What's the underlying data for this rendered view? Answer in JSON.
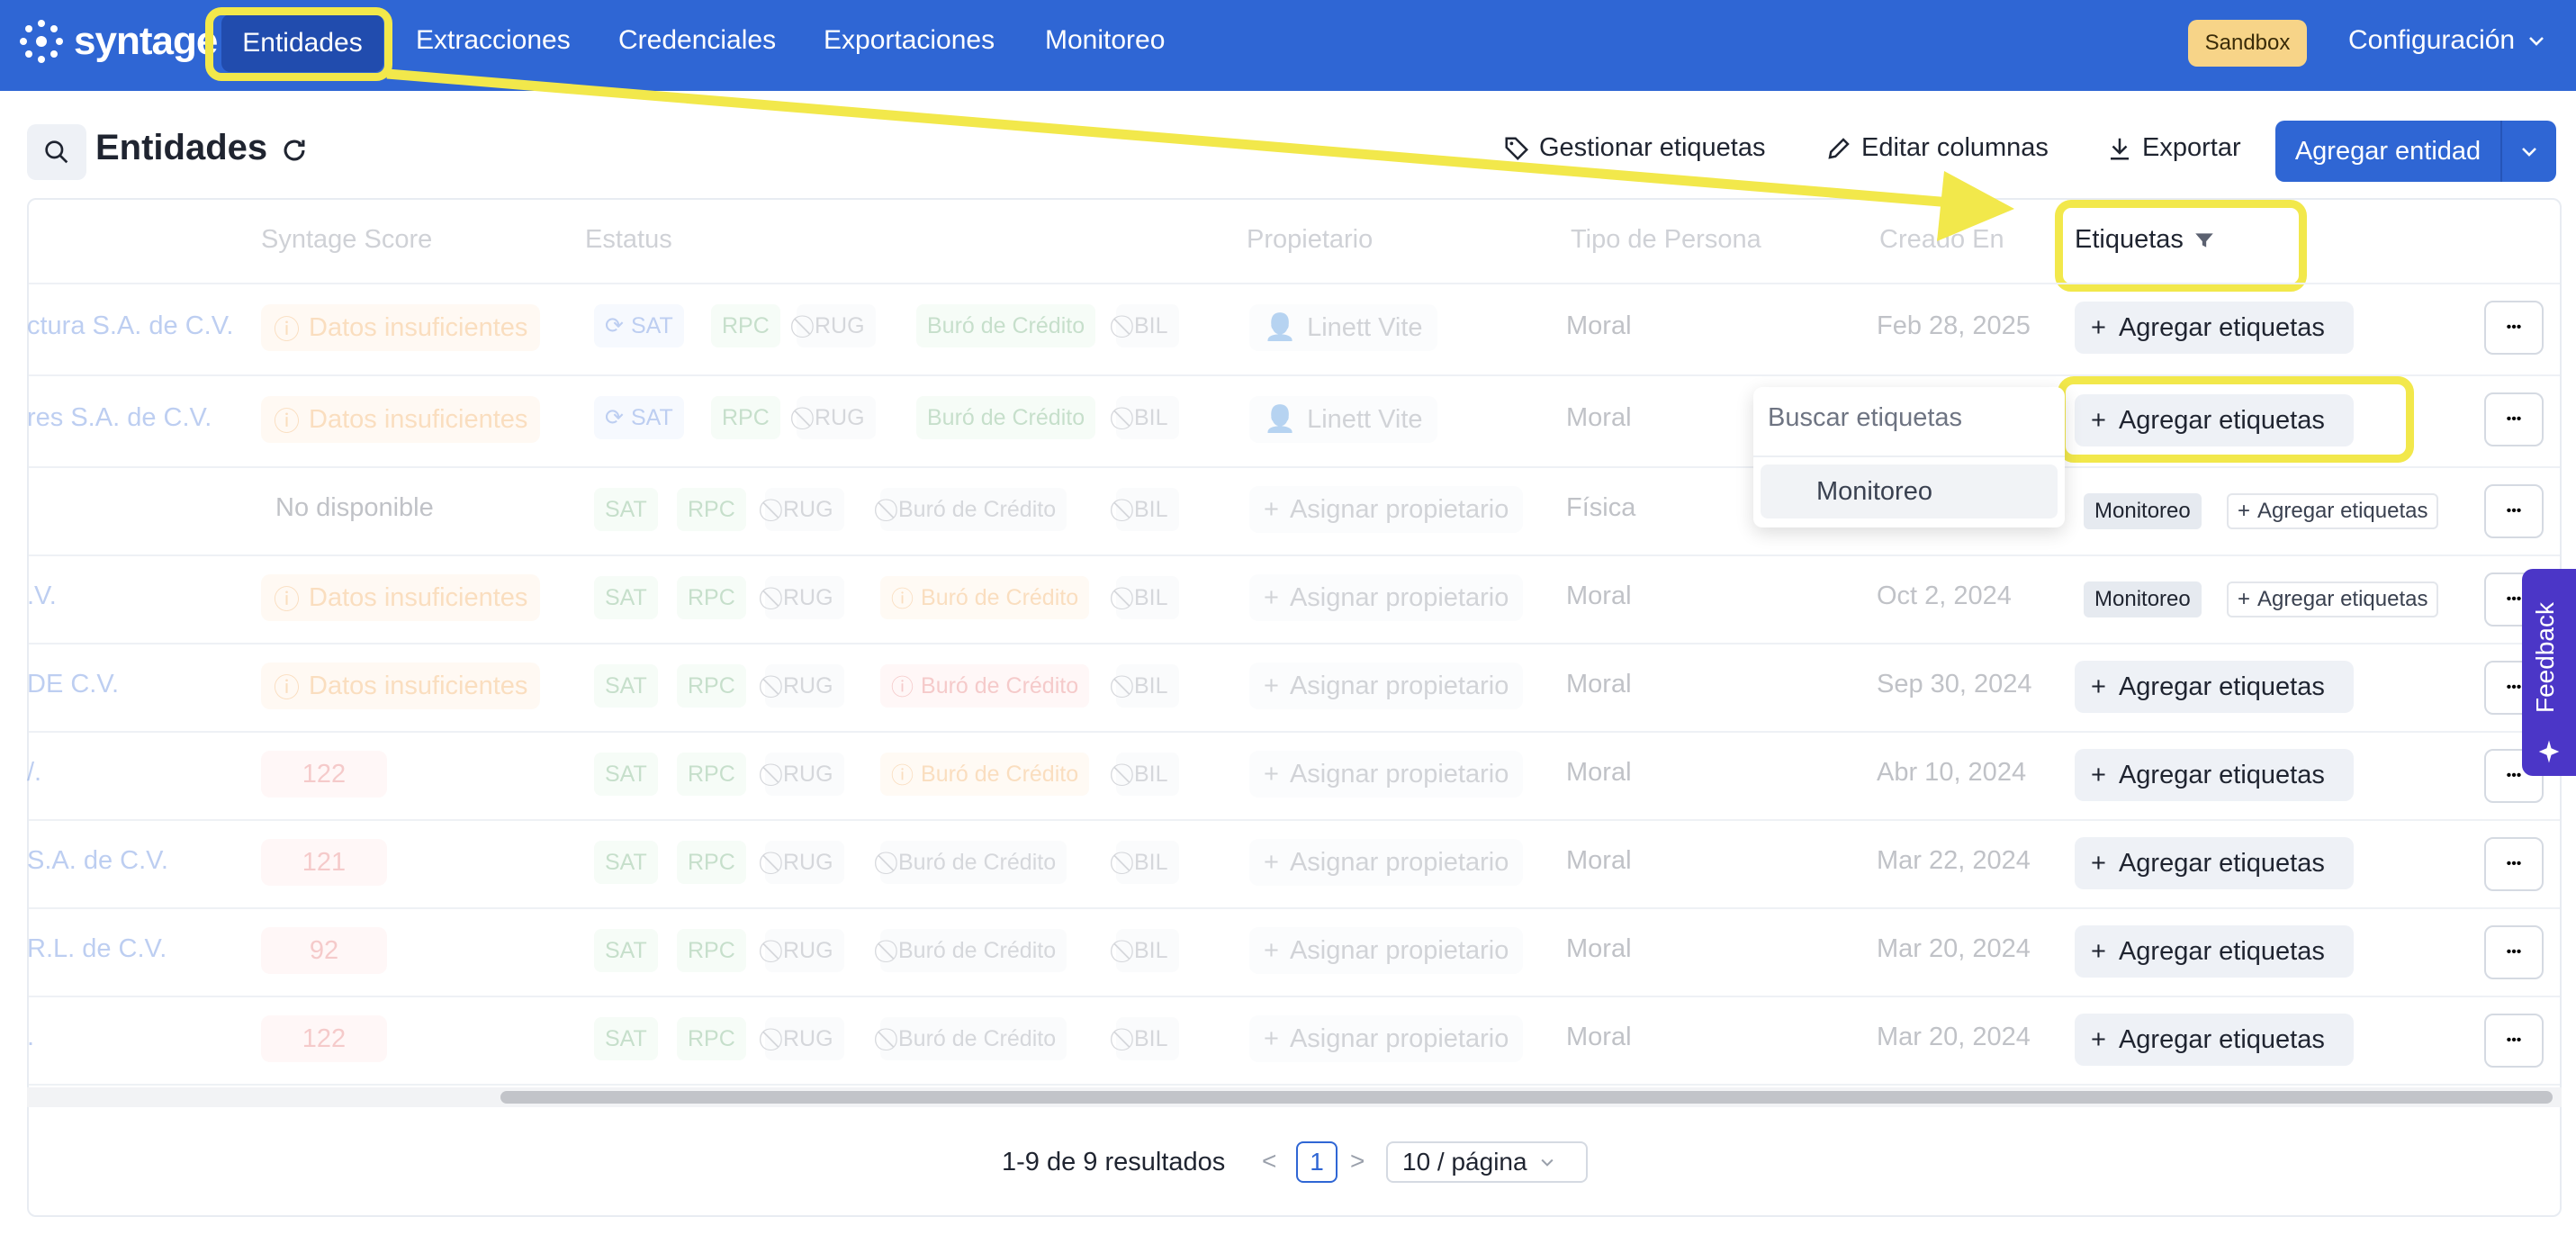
{
  "nav": {
    "logo": "syntage",
    "items": [
      "Entidades",
      "Extracciones",
      "Credenciales",
      "Exportaciones",
      "Monitoreo"
    ],
    "sandbox": "Sandbox",
    "config": "Configuración"
  },
  "header": {
    "title": "Entidades",
    "manage_tags": "Gestionar etiquetas",
    "edit_columns": "Editar columnas",
    "export": "Exportar",
    "add_entity": "Agregar entidad"
  },
  "columns": {
    "score": "Syntage Score",
    "status": "Estatus",
    "owner": "Propietario",
    "person_type": "Tipo de Persona",
    "created": "Creado En",
    "tags": "Etiquetas"
  },
  "rows": [
    {
      "name": "ctura S.A. de C.V.",
      "score": "Datos insuficientes",
      "owner": "Linett Vite",
      "type": "Moral",
      "created": "Feb 28, 2025",
      "tags": []
    },
    {
      "name": "res S.A. de C.V.",
      "score": "Datos insuficientes",
      "owner": "Linett Vite",
      "type": "Moral",
      "created": "",
      "tags": []
    },
    {
      "name": "",
      "score": "No disponible",
      "owner": "Asignar propietario",
      "type": "Física",
      "created": "",
      "tags": [
        "Monitoreo"
      ]
    },
    {
      "name": ".V.",
      "score": "Datos insuficientes",
      "owner": "Asignar propietario",
      "type": "Moral",
      "created": "Oct 2, 2024",
      "tags": [
        "Monitoreo"
      ]
    },
    {
      "name": "DE C.V.",
      "score": "Datos insuficientes",
      "owner": "Asignar propietario",
      "type": "Moral",
      "created": "Sep 30, 2024",
      "tags": []
    },
    {
      "name": "/.",
      "score": "122",
      "owner": "Asignar propietario",
      "type": "Moral",
      "created": "Abr 10, 2024",
      "tags": []
    },
    {
      "name": "S.A. de C.V.",
      "score": "121",
      "owner": "Asignar propietario",
      "type": "Moral",
      "created": "Mar 22, 2024",
      "tags": []
    },
    {
      "name": "R.L. de C.V.",
      "score": "92",
      "owner": "Asignar propietario",
      "type": "Moral",
      "created": "Mar 20, 2024",
      "tags": []
    },
    {
      "name": ".",
      "score": "122",
      "owner": "Asignar propietario",
      "type": "Moral",
      "created": "Mar 20, 2024",
      "tags": []
    }
  ],
  "status_labels": {
    "sat": "SAT",
    "rpc": "RPC",
    "rug": "RUG",
    "buro": "Buró de Crédito",
    "bil": "BIL"
  },
  "add_tags": "Agregar etiquetas",
  "dropdown": {
    "placeholder": "Buscar etiquetas",
    "option": "Monitoreo"
  },
  "pagination": {
    "summary": "1-9 de 9 resultados",
    "page": "1",
    "size": "10 / página"
  },
  "feedback": "Feedback",
  "colors": {
    "primary": "#2f66d4",
    "highlight": "#f2e84b",
    "sandbox": "#f7d488",
    "feedback": "#4b36c7"
  }
}
